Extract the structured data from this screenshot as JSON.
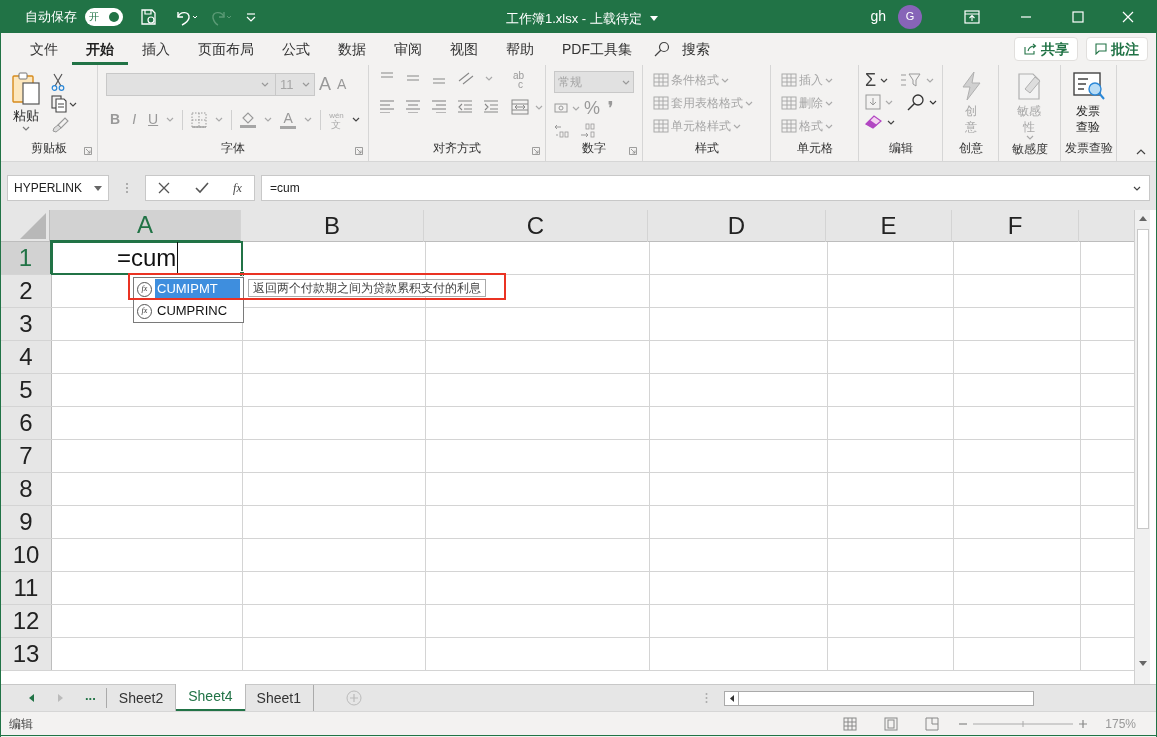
{
  "title_bar": {
    "autosave_label": "自动保存",
    "autosave_toggle": {
      "label": "开",
      "on": true
    },
    "redo_disabled": true,
    "title": "工作簿1.xlsx - 上载待定",
    "user": "gh",
    "avatar": "G"
  },
  "menu_tabs": [
    {
      "label": "文件",
      "selected": false
    },
    {
      "label": "开始",
      "selected": true
    },
    {
      "label": "插入",
      "selected": false
    },
    {
      "label": "页面布局",
      "selected": false
    },
    {
      "label": "公式",
      "selected": false
    },
    {
      "label": "数据",
      "selected": false
    },
    {
      "label": "审阅",
      "selected": false
    },
    {
      "label": "视图",
      "selected": false
    },
    {
      "label": "帮助",
      "selected": false
    },
    {
      "label": "PDF工具集",
      "selected": false
    }
  ],
  "search": {
    "placeholder": "搜索"
  },
  "share_button": "共享",
  "comments_button": "批注",
  "ribbon": [
    {
      "kind": "clipboard",
      "label": "剪贴板",
      "paste": "粘贴"
    },
    {
      "kind": "font",
      "label": "字体",
      "font_size": "11",
      "grow": "A",
      "shrink": "A",
      "bold": "B",
      "italic": "I",
      "underline": "U",
      "font_color": "A",
      "phonetic_top": "wén",
      "phonetic_bottom": "文"
    },
    {
      "kind": "alignment",
      "label": "对齐方式",
      "wrap_top": "ab",
      "wrap_bottom": "c"
    },
    {
      "kind": "number",
      "label": "数字",
      "format": "常规",
      "percent": "%",
      "comma": "❜"
    },
    {
      "kind": "list",
      "label": "样式",
      "items": [
        {
          "label": "条件格式",
          "disabled": true
        },
        {
          "label": "套用表格格式",
          "disabled": true
        },
        {
          "label": "单元格样式",
          "disabled": true
        }
      ]
    },
    {
      "kind": "list",
      "label": "单元格",
      "items": [
        {
          "label": "插入",
          "disabled": true
        },
        {
          "label": "删除",
          "disabled": true
        },
        {
          "label": "格式",
          "disabled": true
        }
      ]
    },
    {
      "kind": "editing",
      "label": "编辑",
      "sum": "Σ"
    },
    {
      "kind": "large_button",
      "label": "创意",
      "button": "创意",
      "disabled": true
    },
    {
      "kind": "large_button",
      "label": "敏感度",
      "button": "敏感性",
      "disabled": true
    },
    {
      "kind": "large_button",
      "label": "发票查验",
      "button": "发票查验",
      "disabled": false
    }
  ],
  "formula_bar": {
    "name_box": "HYPERLINK",
    "insert_function": "fx",
    "value": "=cum"
  },
  "grid": {
    "columns": [
      {
        "label": "A",
        "selected": true
      },
      {
        "label": "B",
        "selected": false
      },
      {
        "label": "C",
        "selected": false
      },
      {
        "label": "D",
        "selected": false
      },
      {
        "label": "E",
        "selected": false
      },
      {
        "label": "F",
        "selected": false
      }
    ],
    "rows": [
      {
        "label": "1",
        "selected": true
      },
      {
        "label": "2",
        "selected": false
      },
      {
        "label": "3",
        "selected": false
      },
      {
        "label": "4",
        "selected": false
      },
      {
        "label": "5",
        "selected": false
      },
      {
        "label": "6",
        "selected": false
      },
      {
        "label": "7",
        "selected": false
      },
      {
        "label": "8",
        "selected": false
      },
      {
        "label": "9",
        "selected": false
      },
      {
        "label": "10",
        "selected": false
      },
      {
        "label": "11",
        "selected": false
      },
      {
        "label": "12",
        "selected": false
      },
      {
        "label": "13",
        "selected": false
      }
    ],
    "active_cell_value": "=cum"
  },
  "autocomplete": {
    "items": [
      {
        "icon": "fx",
        "label": "CUMIPMT",
        "selected": true
      },
      {
        "icon": "fx",
        "label": "CUMPRINC",
        "selected": false
      }
    ],
    "tooltip": "返回两个付款期之间为贷款累积支付的利息"
  },
  "sheet_tabs": {
    "more": "...",
    "tabs": [
      {
        "label": "Sheet2",
        "selected": false
      },
      {
        "label": "Sheet4",
        "selected": true
      },
      {
        "label": "Sheet1",
        "selected": false
      }
    ]
  },
  "status_bar": {
    "mode": "编辑",
    "zoom": "175%"
  }
}
